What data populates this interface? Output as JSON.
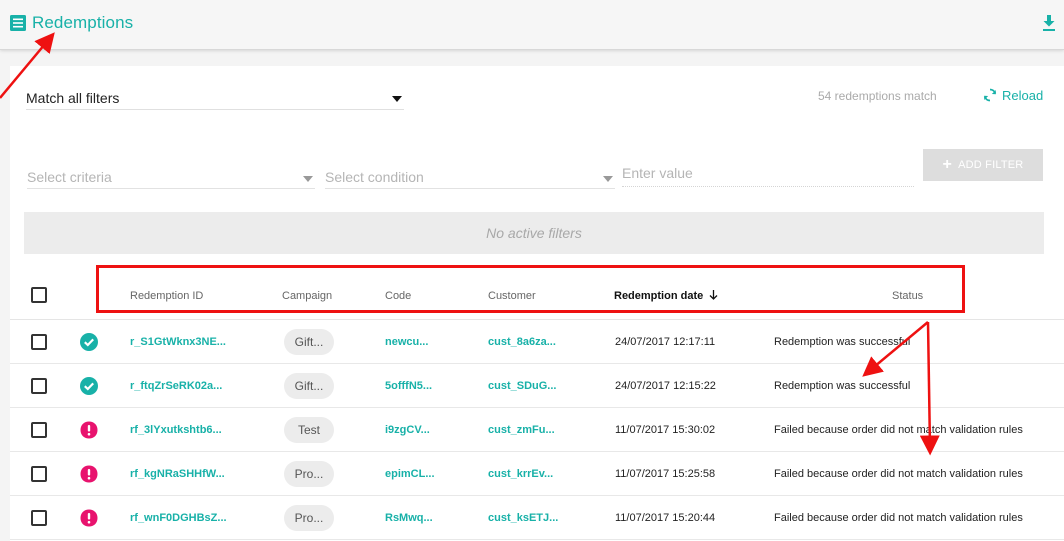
{
  "header": {
    "title": "Redemptions",
    "list_icon": "list-icon",
    "download_icon": "download-icon"
  },
  "toolbar": {
    "match_label": "Match all filters",
    "match_count": "54 redemptions match",
    "reload_label": "Reload"
  },
  "filters": {
    "criteria_placeholder": "Select criteria",
    "condition_placeholder": "Select condition",
    "value_placeholder": "Enter value",
    "add_label": "ADD FILTER",
    "no_active": "No active filters"
  },
  "table": {
    "headers": {
      "id": "Redemption ID",
      "campaign": "Campaign",
      "code": "Code",
      "customer": "Customer",
      "date": "Redemption date",
      "status": "Status"
    },
    "rows": [
      {
        "icon": "check-circle-icon",
        "id": "r_S1GtWknx3NE...",
        "campaign": "Gift...",
        "code": "newcu...",
        "customer": "cust_8a6za...",
        "date": "24/07/2017 12:17:11",
        "status": "Redemption was successful"
      },
      {
        "icon": "check-circle-icon",
        "id": "r_ftqZrSeRK02a...",
        "campaign": "Gift...",
        "code": "5offfN5...",
        "customer": "cust_SDuG...",
        "date": "24/07/2017 12:15:22",
        "status": "Redemption was successful"
      },
      {
        "icon": "alert-circle-icon",
        "id": "rf_3lYxutkshtb6...",
        "campaign": "Test",
        "code": "i9zgCV...",
        "customer": "cust_zmFu...",
        "date": "11/07/2017 15:30:02",
        "status": "Failed because order did not match validation rules"
      },
      {
        "icon": "alert-circle-icon",
        "id": "rf_kgNRaSHHfW...",
        "campaign": "Pro...",
        "code": "epimCL...",
        "customer": "cust_krrEv...",
        "date": "11/07/2017 15:25:58",
        "status": "Failed because order did not match validation rules"
      },
      {
        "icon": "alert-circle-icon",
        "id": "rf_wnF0DGHBsZ...",
        "campaign": "Pro...",
        "code": "RsMwq...",
        "customer": "cust_ksETJ...",
        "date": "11/07/2017 15:20:44",
        "status": "Failed because order did not match validation rules"
      }
    ]
  },
  "colors": {
    "accent": "#18b1a8",
    "success": "#18b1a8",
    "error": "#e8136e",
    "annotation": "#ee1111"
  }
}
